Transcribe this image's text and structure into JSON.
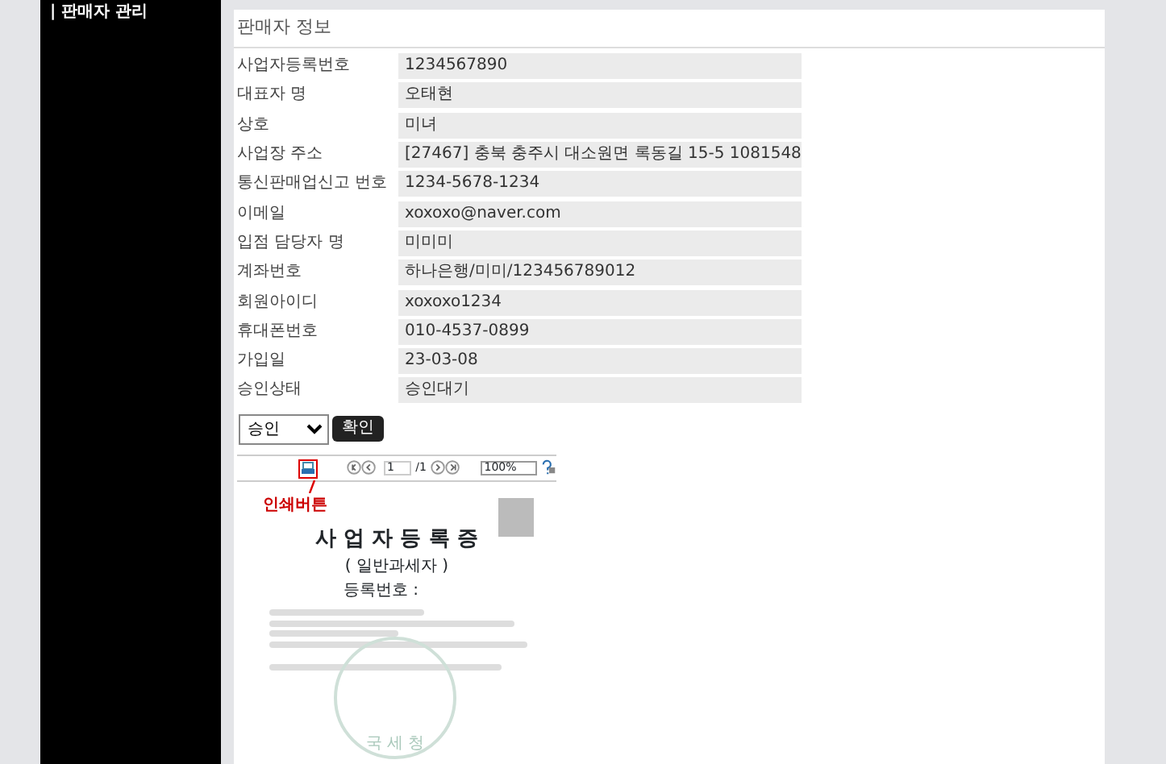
{
  "sidebar": {
    "title": "| 판매자 관리"
  },
  "panel": {
    "title": "판매자 정보"
  },
  "fields": [
    {
      "label": "사업자등록번호",
      "value": "1234567890"
    },
    {
      "label": "대표자 명",
      "value": "오태현"
    },
    {
      "label": "상호",
      "value": "미녀"
    },
    {
      "label": "사업장 주소",
      "value": "[27467] 충북 충주시 대소원면 록동길 15-5 1081548"
    },
    {
      "label": "통신판매업신고 번호",
      "value": "1234-5678-1234"
    },
    {
      "label": "이메일",
      "value": "xoxoxo@naver.com"
    },
    {
      "label": "입점 담당자 명",
      "value": "미미미"
    },
    {
      "label": "계좌번호",
      "value": "하나은행/미미/123456789012"
    },
    {
      "label": "회원아이디",
      "value": "xoxoxo1234"
    },
    {
      "label": "휴대폰번호",
      "value": "010-4537-0899"
    },
    {
      "label": "가입일",
      "value": "23-03-08"
    },
    {
      "label": "승인상태",
      "value": "승인대기"
    }
  ],
  "approval": {
    "select_value": "승인",
    "confirm_button": "확인"
  },
  "viewer": {
    "page": "1",
    "page_total": "/1",
    "zoom": "100%",
    "print_annotation": "인쇄버튼",
    "document": {
      "title": "사 업 자 등 록 증",
      "subtitle": "( 일반과세자 )",
      "number_label": "등록번호 :",
      "seal": "국 세 청"
    }
  }
}
